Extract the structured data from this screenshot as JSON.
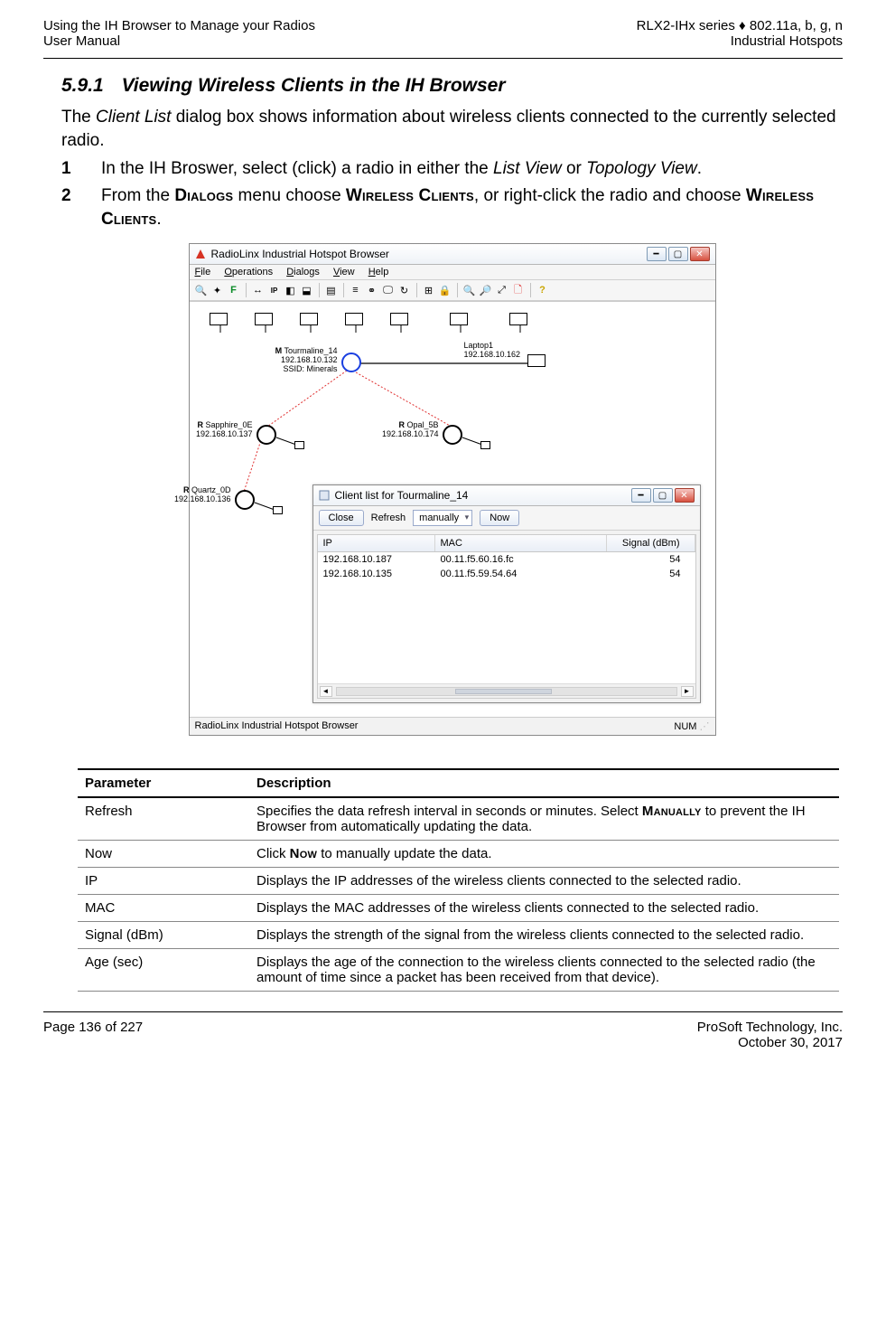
{
  "header": {
    "left_line1": "Using the IH Browser to Manage your Radios",
    "left_line2": "User Manual",
    "right_line1": "RLX2-IHx series ♦ 802.11a, b, g, n",
    "right_line2": "Industrial Hotspots"
  },
  "section": {
    "number": "5.9.1",
    "title": "Viewing Wireless Clients in the IH Browser"
  },
  "intro": {
    "pre": "The ",
    "dialog_name": "Client List",
    "post": " dialog box shows information about wireless clients connected to the currently selected radio."
  },
  "steps": [
    {
      "num": "1",
      "pre": "In the IH Broswer, select (click) a radio in either the ",
      "i1": "List View",
      "mid": " or ",
      "i2": "Topology View",
      "post": "."
    },
    {
      "num": "2",
      "pre": "From the ",
      "sc1": "Dialogs",
      "mid1": " menu choose ",
      "sc2": "Wireless Clients",
      "mid2": ", or right-click the radio and choose ",
      "sc3": "Wireless Clients",
      "post": "."
    }
  ],
  "outer_window": {
    "title": "RadioLinx Industrial Hotspot Browser",
    "menus": {
      "file": "File",
      "operations": "Operations",
      "dialogs": "Dialogs",
      "view": "View",
      "help": "Help"
    },
    "status_left": "RadioLinx Industrial Hotspot Browser",
    "status_right": "NUM"
  },
  "topology": {
    "master": {
      "tag": "M",
      "name": "Tourmaline_14",
      "ip": "192.168.10.132",
      "ssid_label": "SSID: Minerals"
    },
    "laptop": {
      "name": "Laptop1",
      "ip": "192.168.10.162"
    },
    "sapphire": {
      "tag": "R",
      "name": "Sapphire_0E",
      "ip": "192.168.10.137"
    },
    "opal": {
      "tag": "R",
      "name": "Opal_5B",
      "ip": "192.168.10.174"
    },
    "quartz": {
      "tag": "R",
      "name": "Quartz_0D",
      "ip": "192.168.10.136"
    }
  },
  "client_window": {
    "title": "Client list for Tourmaline_14",
    "close_label": "Close",
    "refresh_label": "Refresh",
    "refresh_mode": "manually",
    "now_label": "Now",
    "columns": {
      "ip": "IP",
      "mac": "MAC",
      "signal": "Signal (dBm)"
    },
    "rows": [
      {
        "ip": "192.168.10.187",
        "mac": "00.11.f5.60.16.fc",
        "signal": "54"
      },
      {
        "ip": "192.168.10.135",
        "mac": "00.11.f5.59.54.64",
        "signal": "54"
      }
    ]
  },
  "params_table": {
    "head_param": "Parameter",
    "head_desc": "Description",
    "rows": [
      {
        "param": "Refresh",
        "desc_pre": "Specifies the data refresh interval in seconds or minutes. Select ",
        "desc_sc": "Manually",
        "desc_post": " to prevent the IH Browser from automatically updating the data."
      },
      {
        "param": "Now",
        "desc_pre": "Click ",
        "desc_sc": "Now",
        "desc_post": " to manually update the data."
      },
      {
        "param": "IP",
        "desc_plain": "Displays the IP addresses of the wireless clients connected to the selected radio."
      },
      {
        "param": "MAC",
        "desc_plain": "Displays the MAC addresses of the wireless clients connected to the selected radio."
      },
      {
        "param": "Signal (dBm)",
        "desc_plain": "Displays the strength of the signal from the wireless clients connected to the selected radio."
      },
      {
        "param": "Age (sec)",
        "desc_plain": "Displays the age of the connection to the wireless clients connected to the selected radio (the amount of time since a packet has been received from that device)."
      }
    ]
  },
  "footer": {
    "left": "Page 136 of 227",
    "right_line1": "ProSoft Technology, Inc.",
    "right_line2": "October 30, 2017"
  }
}
